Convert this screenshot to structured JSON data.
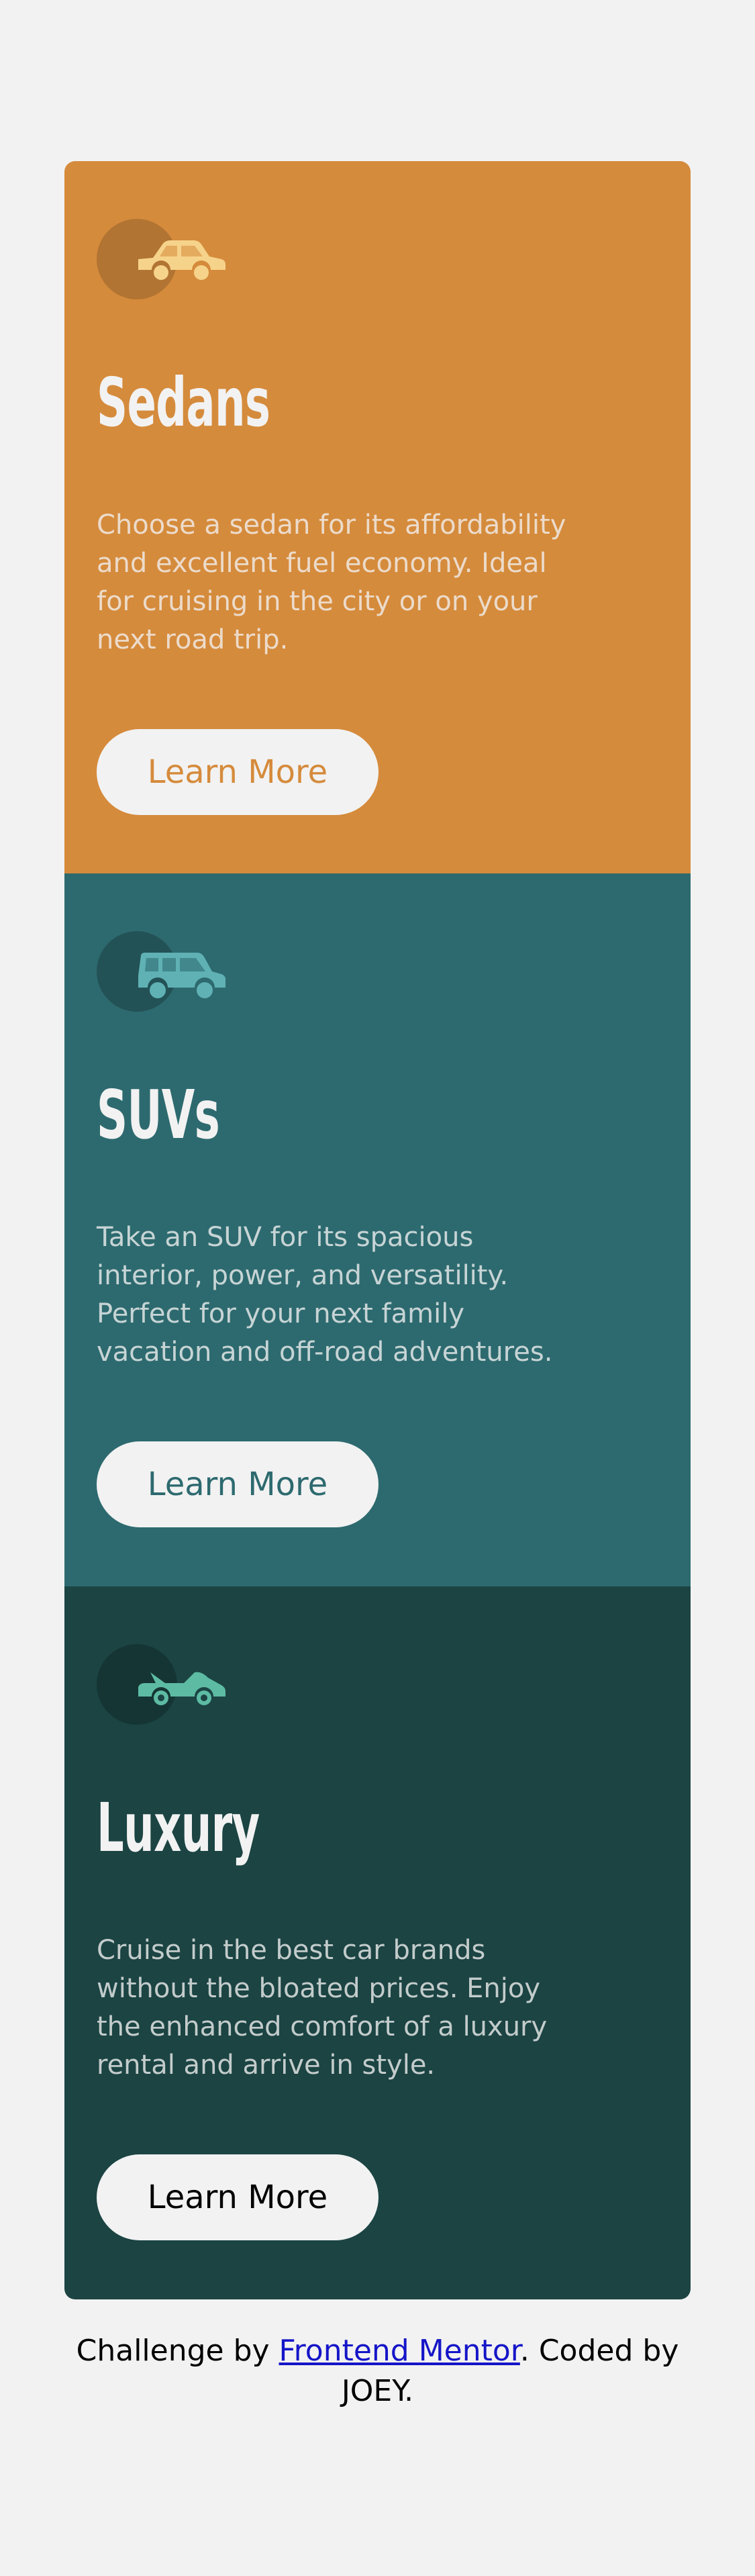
{
  "colors": {
    "page_background": "#f2f2f2",
    "sedans": "#d58b3c",
    "suvs": "#2d6a6f",
    "luxury": "#1b4443",
    "card_text": "#f2f2f2",
    "button_background": "#f2f2f2",
    "link": "#1515c8"
  },
  "cards": [
    {
      "icon": "sedan-car-icon",
      "title": "Sedans",
      "description": "Choose a sedan for its affordability and excellent fuel economy. Ideal for cruising in the city or on your next road trip.",
      "button_label": "Learn More",
      "background": "#d58b3c",
      "button_text_color": "#d58b3c",
      "icon_color": "#f6d38a"
    },
    {
      "icon": "suv-car-icon",
      "title": "SUVs",
      "description": "Take an SUV for its spacious interior, power, and versatility. Perfect for your next family vacation and off-road adventures.",
      "button_label": "Learn More",
      "background": "#2d6a6f",
      "button_text_color": "#2d6a6f",
      "icon_color": "#5fb1b4"
    },
    {
      "icon": "luxury-car-icon",
      "title": "Luxury",
      "description": "Cruise in the best car brands without the bloated prices. Enjoy the enhanced comfort of a luxury rental and arrive in style.",
      "button_label": "Learn More",
      "background": "#1b4443",
      "button_text_color": "#000000",
      "icon_color": "#5dbba3"
    }
  ],
  "footer": {
    "prefix": "Challenge by ",
    "link_text": "Frontend Mentor",
    "suffix": ". Coded by JOEY."
  }
}
